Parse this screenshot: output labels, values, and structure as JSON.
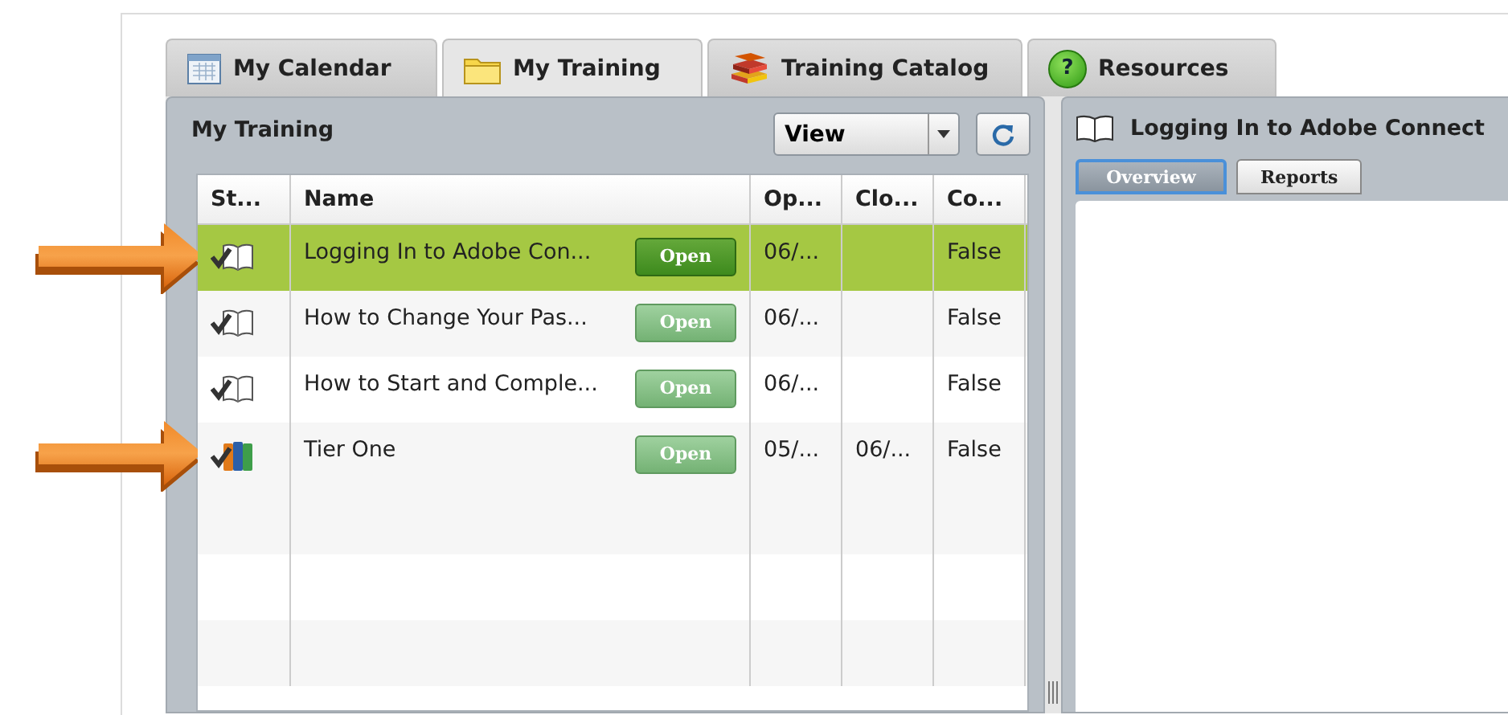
{
  "tabs": [
    {
      "label": "My Calendar",
      "kind": "calendar",
      "selected": false
    },
    {
      "label": "My Training",
      "kind": "folder",
      "selected": true
    },
    {
      "label": "Training Catalog",
      "kind": "books",
      "selected": false
    },
    {
      "label": "Resources",
      "kind": "help",
      "icon_text": "?",
      "selected": false
    }
  ],
  "my_training": {
    "title": "My Training",
    "view_select": {
      "value": "View"
    },
    "columns": [
      "St...",
      "Name",
      "Op...",
      "Clo...",
      "Co..."
    ],
    "rows": [
      {
        "kind": "course",
        "name": "Logging In to Adobe Con...",
        "button": "Open",
        "opens": "06/...",
        "complete": "False",
        "selected": true,
        "pointed": true
      },
      {
        "kind": "course",
        "name": "How to Change Your Pas...",
        "button": "Open",
        "opens": "06/...",
        "complete": "False",
        "selected": false,
        "pointed": false
      },
      {
        "kind": "course",
        "name": "How to Start and Comple...",
        "button": "Open",
        "opens": "06/...",
        "complete": "False",
        "selected": false,
        "pointed": false
      },
      {
        "kind": "curriculum",
        "name": "Tier One",
        "button": "Open",
        "opens": "05/...",
        "closes": "06/...",
        "complete": "False",
        "selected": false,
        "pointed": true
      }
    ]
  },
  "detail": {
    "title": "Logging In to Adobe Connect",
    "tabs": [
      {
        "label": "Overview",
        "selected": true
      },
      {
        "label": "Reports",
        "selected": false
      }
    ]
  }
}
